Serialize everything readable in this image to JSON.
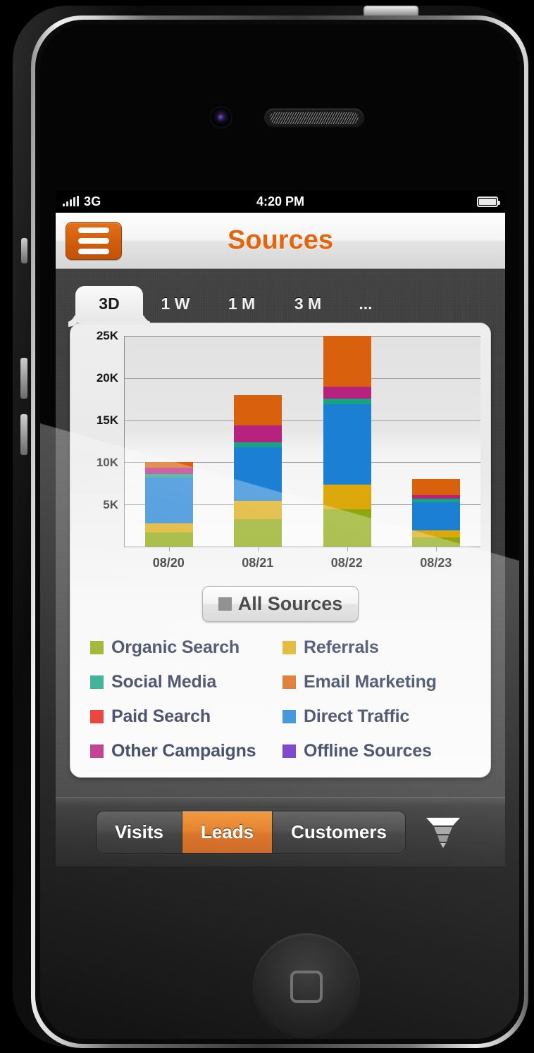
{
  "status_bar": {
    "signal_icon": "signal-bars-icon",
    "carrier": "3G",
    "time": "4:20 PM",
    "battery_icon": "battery-full-icon"
  },
  "nav_bar": {
    "menu_icon": "hamburger-menu-icon",
    "title": "Sources"
  },
  "tabs": [
    {
      "label": "3D",
      "active": true
    },
    {
      "label": "1 W",
      "active": false
    },
    {
      "label": "1 M",
      "active": false
    },
    {
      "label": "3 M",
      "active": false
    },
    {
      "label": "...",
      "active": false
    }
  ],
  "all_sources_button": {
    "label": "All Sources",
    "swatch_color": "#6f6f6f"
  },
  "legend": [
    {
      "label": "Organic Search",
      "color": "#8ca80e"
    },
    {
      "label": "Referrals",
      "color": "#dca80c"
    },
    {
      "label": "Social Media",
      "color": "#18a383"
    },
    {
      "label": "Email Marketing",
      "color": "#d9600c"
    },
    {
      "label": "Paid Search",
      "color": "#e8211b"
    },
    {
      "label": "Direct Traffic",
      "color": "#1b7fd4"
    },
    {
      "label": "Other Campaigns",
      "color": "#b7227e"
    },
    {
      "label": "Offline Sources",
      "color": "#6423c4"
    }
  ],
  "bottom_bar": {
    "segments": [
      {
        "label": "Visits",
        "active": false
      },
      {
        "label": "Leads",
        "active": true
      },
      {
        "label": "Customers",
        "active": false
      }
    ],
    "funnel_icon": "funnel-icon"
  },
  "chart_data": {
    "type": "bar",
    "stacked": true,
    "title": "Sources",
    "xlabel": "",
    "ylabel": "",
    "ylim": [
      0,
      25000
    ],
    "yticks": [
      5000,
      10000,
      15000,
      20000,
      25000
    ],
    "ytick_labels": [
      "5K",
      "10K",
      "15K",
      "20K",
      "25K"
    ],
    "grid": true,
    "legend_position": "below-chart",
    "categories": [
      "08/20",
      "08/21",
      "08/22",
      "08/23"
    ],
    "totals": [
      10000,
      18000,
      25000,
      8000
    ],
    "series": [
      {
        "name": "Organic Search",
        "color": "#8ca80e",
        "values": [
          1700,
          3300,
          4400,
          1100
        ]
      },
      {
        "name": "Referrals",
        "color": "#dca80c",
        "values": [
          1100,
          2100,
          3000,
          800
        ]
      },
      {
        "name": "Paid Search",
        "color": "#e8211b",
        "values": [
          0,
          0,
          0,
          0
        ]
      },
      {
        "name": "Direct Traffic",
        "color": "#1b7fd4",
        "values": [
          5400,
          6400,
          9500,
          3400
        ]
      },
      {
        "name": "Social Media",
        "color": "#18a383",
        "values": [
          450,
          600,
          700,
          350
        ]
      },
      {
        "name": "Other Campaigns",
        "color": "#b7227e",
        "values": [
          750,
          2000,
          1400,
          450
        ]
      },
      {
        "name": "Offline Sources",
        "color": "#6423c4",
        "values": [
          0,
          0,
          0,
          0
        ]
      },
      {
        "name": "Email Marketing",
        "color": "#d9600c",
        "values": [
          600,
          3600,
          6000,
          1900
        ]
      }
    ]
  }
}
